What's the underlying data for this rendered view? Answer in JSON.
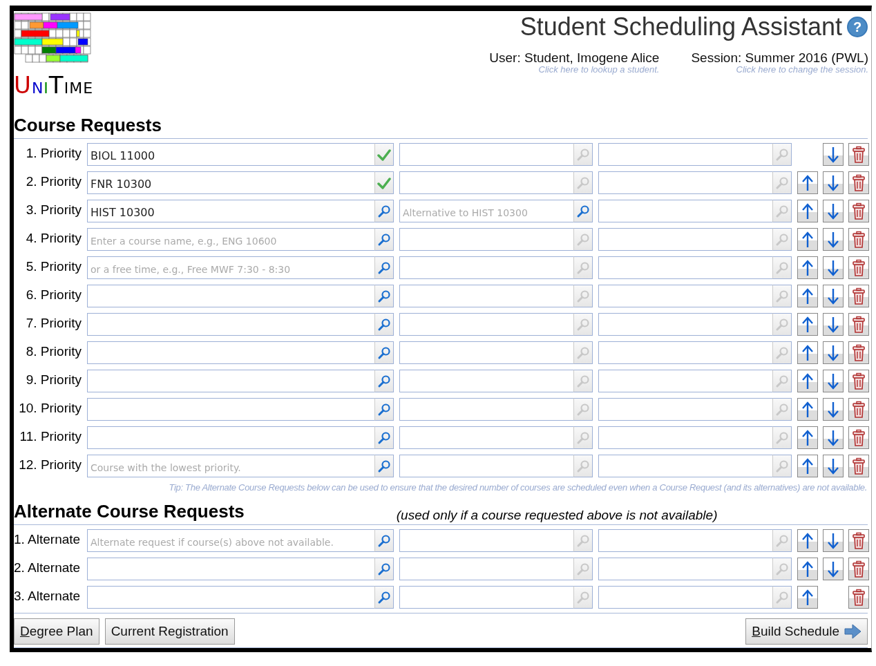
{
  "header": {
    "logo_text": "UNITIME",
    "title": "Student Scheduling Assistant",
    "help": "?",
    "user": {
      "label": "User:",
      "value": "Student, Imogene Alice",
      "link": "Click here to lookup a student."
    },
    "session": {
      "label": "Session:",
      "value": "Summer 2016 (PWL)",
      "link": "Click here to change the session."
    }
  },
  "course_requests": {
    "heading": "Course Requests",
    "rows": [
      {
        "label": "1. Priority",
        "fields": [
          {
            "value": "BIOL 11000",
            "kind": "check"
          },
          {
            "kind": "search",
            "disabled": true
          },
          {
            "kind": "search",
            "disabled": true
          }
        ],
        "move_up": false,
        "move_down": true
      },
      {
        "label": "2. Priority",
        "fields": [
          {
            "value": "FNR 10300",
            "kind": "check"
          },
          {
            "kind": "search",
            "disabled": true
          },
          {
            "kind": "search",
            "disabled": true
          }
        ],
        "move_up": true,
        "move_down": true
      },
      {
        "label": "3. Priority",
        "fields": [
          {
            "value": "HIST 10300",
            "kind": "search",
            "disabled": false
          },
          {
            "placeholder": "Alternative to HIST 10300",
            "kind": "search",
            "disabled": false
          },
          {
            "kind": "search",
            "disabled": true
          }
        ],
        "move_up": true,
        "move_down": true
      },
      {
        "label": "4. Priority",
        "fields": [
          {
            "placeholder": "Enter a course name, e.g., ENG 10600",
            "kind": "search",
            "disabled": false
          },
          {
            "kind": "search",
            "disabled": true
          },
          {
            "kind": "search",
            "disabled": true
          }
        ],
        "move_up": true,
        "move_down": true
      },
      {
        "label": "5. Priority",
        "fields": [
          {
            "placeholder": "or a free time, e.g., Free MWF 7:30 - 8:30",
            "kind": "search",
            "disabled": false
          },
          {
            "kind": "search",
            "disabled": true
          },
          {
            "kind": "search",
            "disabled": true
          }
        ],
        "move_up": true,
        "move_down": true
      },
      {
        "label": "6. Priority",
        "fields": [
          {
            "kind": "search",
            "disabled": false
          },
          {
            "kind": "search",
            "disabled": true
          },
          {
            "kind": "search",
            "disabled": true
          }
        ],
        "move_up": true,
        "move_down": true
      },
      {
        "label": "7. Priority",
        "fields": [
          {
            "kind": "search",
            "disabled": false
          },
          {
            "kind": "search",
            "disabled": true
          },
          {
            "kind": "search",
            "disabled": true
          }
        ],
        "move_up": true,
        "move_down": true
      },
      {
        "label": "8. Priority",
        "fields": [
          {
            "kind": "search",
            "disabled": false
          },
          {
            "kind": "search",
            "disabled": true
          },
          {
            "kind": "search",
            "disabled": true
          }
        ],
        "move_up": true,
        "move_down": true
      },
      {
        "label": "9. Priority",
        "fields": [
          {
            "kind": "search",
            "disabled": false
          },
          {
            "kind": "search",
            "disabled": true
          },
          {
            "kind": "search",
            "disabled": true
          }
        ],
        "move_up": true,
        "move_down": true
      },
      {
        "label": "10. Priority",
        "fields": [
          {
            "kind": "search",
            "disabled": false
          },
          {
            "kind": "search",
            "disabled": true
          },
          {
            "kind": "search",
            "disabled": true
          }
        ],
        "move_up": true,
        "move_down": true
      },
      {
        "label": "11. Priority",
        "fields": [
          {
            "kind": "search",
            "disabled": false
          },
          {
            "kind": "search",
            "disabled": true
          },
          {
            "kind": "search",
            "disabled": true
          }
        ],
        "move_up": true,
        "move_down": true
      },
      {
        "label": "12. Priority",
        "fields": [
          {
            "placeholder": "Course with the lowest priority.",
            "kind": "search",
            "disabled": false
          },
          {
            "kind": "search",
            "disabled": true
          },
          {
            "kind": "search",
            "disabled": true
          }
        ],
        "move_up": true,
        "move_down": true
      }
    ],
    "tip": "Tip: The Alternate Course Requests below can be used to ensure that the desired number of courses are scheduled even when a Course Request (and its alternatives) are not available."
  },
  "alternate_requests": {
    "heading": "Alternate Course Requests",
    "note": "(used only if a course requested above is not available)",
    "rows": [
      {
        "label": "1. Alternate",
        "fields": [
          {
            "placeholder": "Alternate request if course(s) above not available.",
            "kind": "search",
            "disabled": false
          },
          {
            "kind": "search",
            "disabled": true
          },
          {
            "kind": "search",
            "disabled": true
          }
        ],
        "move_up": true,
        "move_down": true
      },
      {
        "label": "2. Alternate",
        "fields": [
          {
            "kind": "search",
            "disabled": false
          },
          {
            "kind": "search",
            "disabled": true
          },
          {
            "kind": "search",
            "disabled": true
          }
        ],
        "move_up": true,
        "move_down": true
      },
      {
        "label": "3. Alternate",
        "fields": [
          {
            "kind": "search",
            "disabled": false
          },
          {
            "kind": "search",
            "disabled": true
          },
          {
            "kind": "search",
            "disabled": true
          }
        ],
        "move_up": true,
        "move_down": false
      }
    ]
  },
  "buttons_left": [
    {
      "label": "Degree Plan",
      "underline_first": true
    },
    {
      "label": "Current Registration",
      "underline_first": false
    }
  ],
  "buttons_right": [
    {
      "label": "Build Schedule",
      "underline_first": true,
      "kind": "arrow"
    }
  ]
}
